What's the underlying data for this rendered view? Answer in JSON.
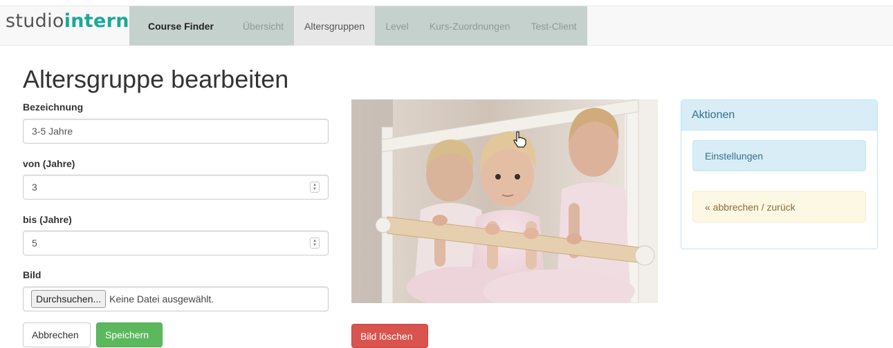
{
  "brand": {
    "part1": "studio",
    "part2": "intern"
  },
  "nav": {
    "home": "Course Finder",
    "items": [
      "Übersicht",
      "Altersgruppen",
      "Level",
      "Kurs-Zuordnungen",
      "Test-Client"
    ],
    "active": "Altersgruppen"
  },
  "page": {
    "title": "Altersgruppe bearbeiten"
  },
  "form": {
    "bezeichnung": {
      "label": "Bezeichnung",
      "value": "3-5 Jahre"
    },
    "von": {
      "label": "von (Jahre)",
      "value": "3"
    },
    "bis": {
      "label": "bis (Jahre)",
      "value": "5"
    },
    "bild": {
      "label": "Bild",
      "button": "Durchsuchen...",
      "status": "Keine Datei ausgewählt."
    },
    "cancel": "Abbrechen",
    "save": "Speichern"
  },
  "image": {
    "delete": "Bild löschen"
  },
  "panel": {
    "heading": "Aktionen",
    "settings": "Einstellungen",
    "back": "« abbrechen / zurück"
  },
  "colors": {
    "brand_accent": "#1aa89a",
    "nav_bg": "#c5d1cd",
    "nav_active": "#e7e7e7",
    "success": "#5cb85c",
    "danger": "#d9534f",
    "info_bg": "#d9edf7",
    "warning_bg": "#fcf8e3"
  }
}
